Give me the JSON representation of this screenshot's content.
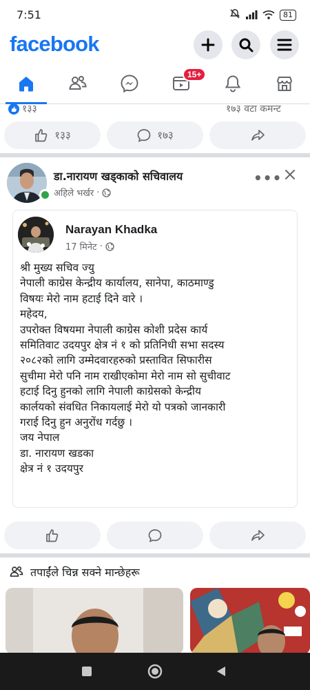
{
  "status_bar": {
    "time": "7:51",
    "battery": "81",
    "icons": [
      "mute-icon",
      "signal-icon",
      "wifi-icon",
      "battery-icon"
    ]
  },
  "header": {
    "logo": "facebook",
    "actions": [
      "create-icon",
      "search-icon",
      "menu-icon"
    ]
  },
  "nav": {
    "tabs": [
      "home",
      "friends",
      "messenger",
      "video",
      "notifications",
      "marketplace"
    ],
    "active": "home",
    "video_badge": "15+"
  },
  "previous_post": {
    "reaction_count": "१३३",
    "comment_count": "१७३ वटा कमन्ट",
    "like_count": "१३३",
    "comments_label": "१७३"
  },
  "post": {
    "page_name": "डा.नारायण खड्काको सचिवालय",
    "time": "अहिले भर्खर",
    "shared": {
      "author": "Narayan Khadka",
      "time": "17 मिनेट",
      "lines": [
        "श्री मुख्य सचिव ज्यु",
        "नेपाली काग्रेस केन्द्रीय कार्यालय, सानेपा, काठमाण्डु",
        "विषयः मेरो नाम हटाई दिने वारे ।",
        "महेदय,",
        "उपरोक्त विषयमा नेपाली काग्रेस कोशी प्रदेस कार्य",
        "समितिवाट उदयपुर क्षेत्र नं १ को प्रतिनिधी सभा सदस्य",
        "२०८२को लागि उम्मेदवारहरुको  प्रस्तावित सिफारीस",
        "सुचीमा मेरो पनि नाम राखीएकोमा मेरो नाम सो सुचीवाट",
        "हटाई दिनु हुनको लागि नेपाली काग्रेसको केन्द्रीय",
        "कार्लयको संवधित निकायलाई मेरो यो पत्रको जानकारी",
        "गराई दिनु हुन अनुरोंध गर्दछु ।",
        "जय नेपाल",
        "डा. नारायण खडका",
        "क्षेत्र नं १ उदयपुर"
      ]
    }
  },
  "people_you_may_know": {
    "title": "तपाईंले चिन्न सक्ने मान्छेहरू"
  },
  "colors": {
    "brand": "#1877f2",
    "badge": "#e41e3f",
    "online": "#31a24c",
    "muted": "#65676b"
  }
}
